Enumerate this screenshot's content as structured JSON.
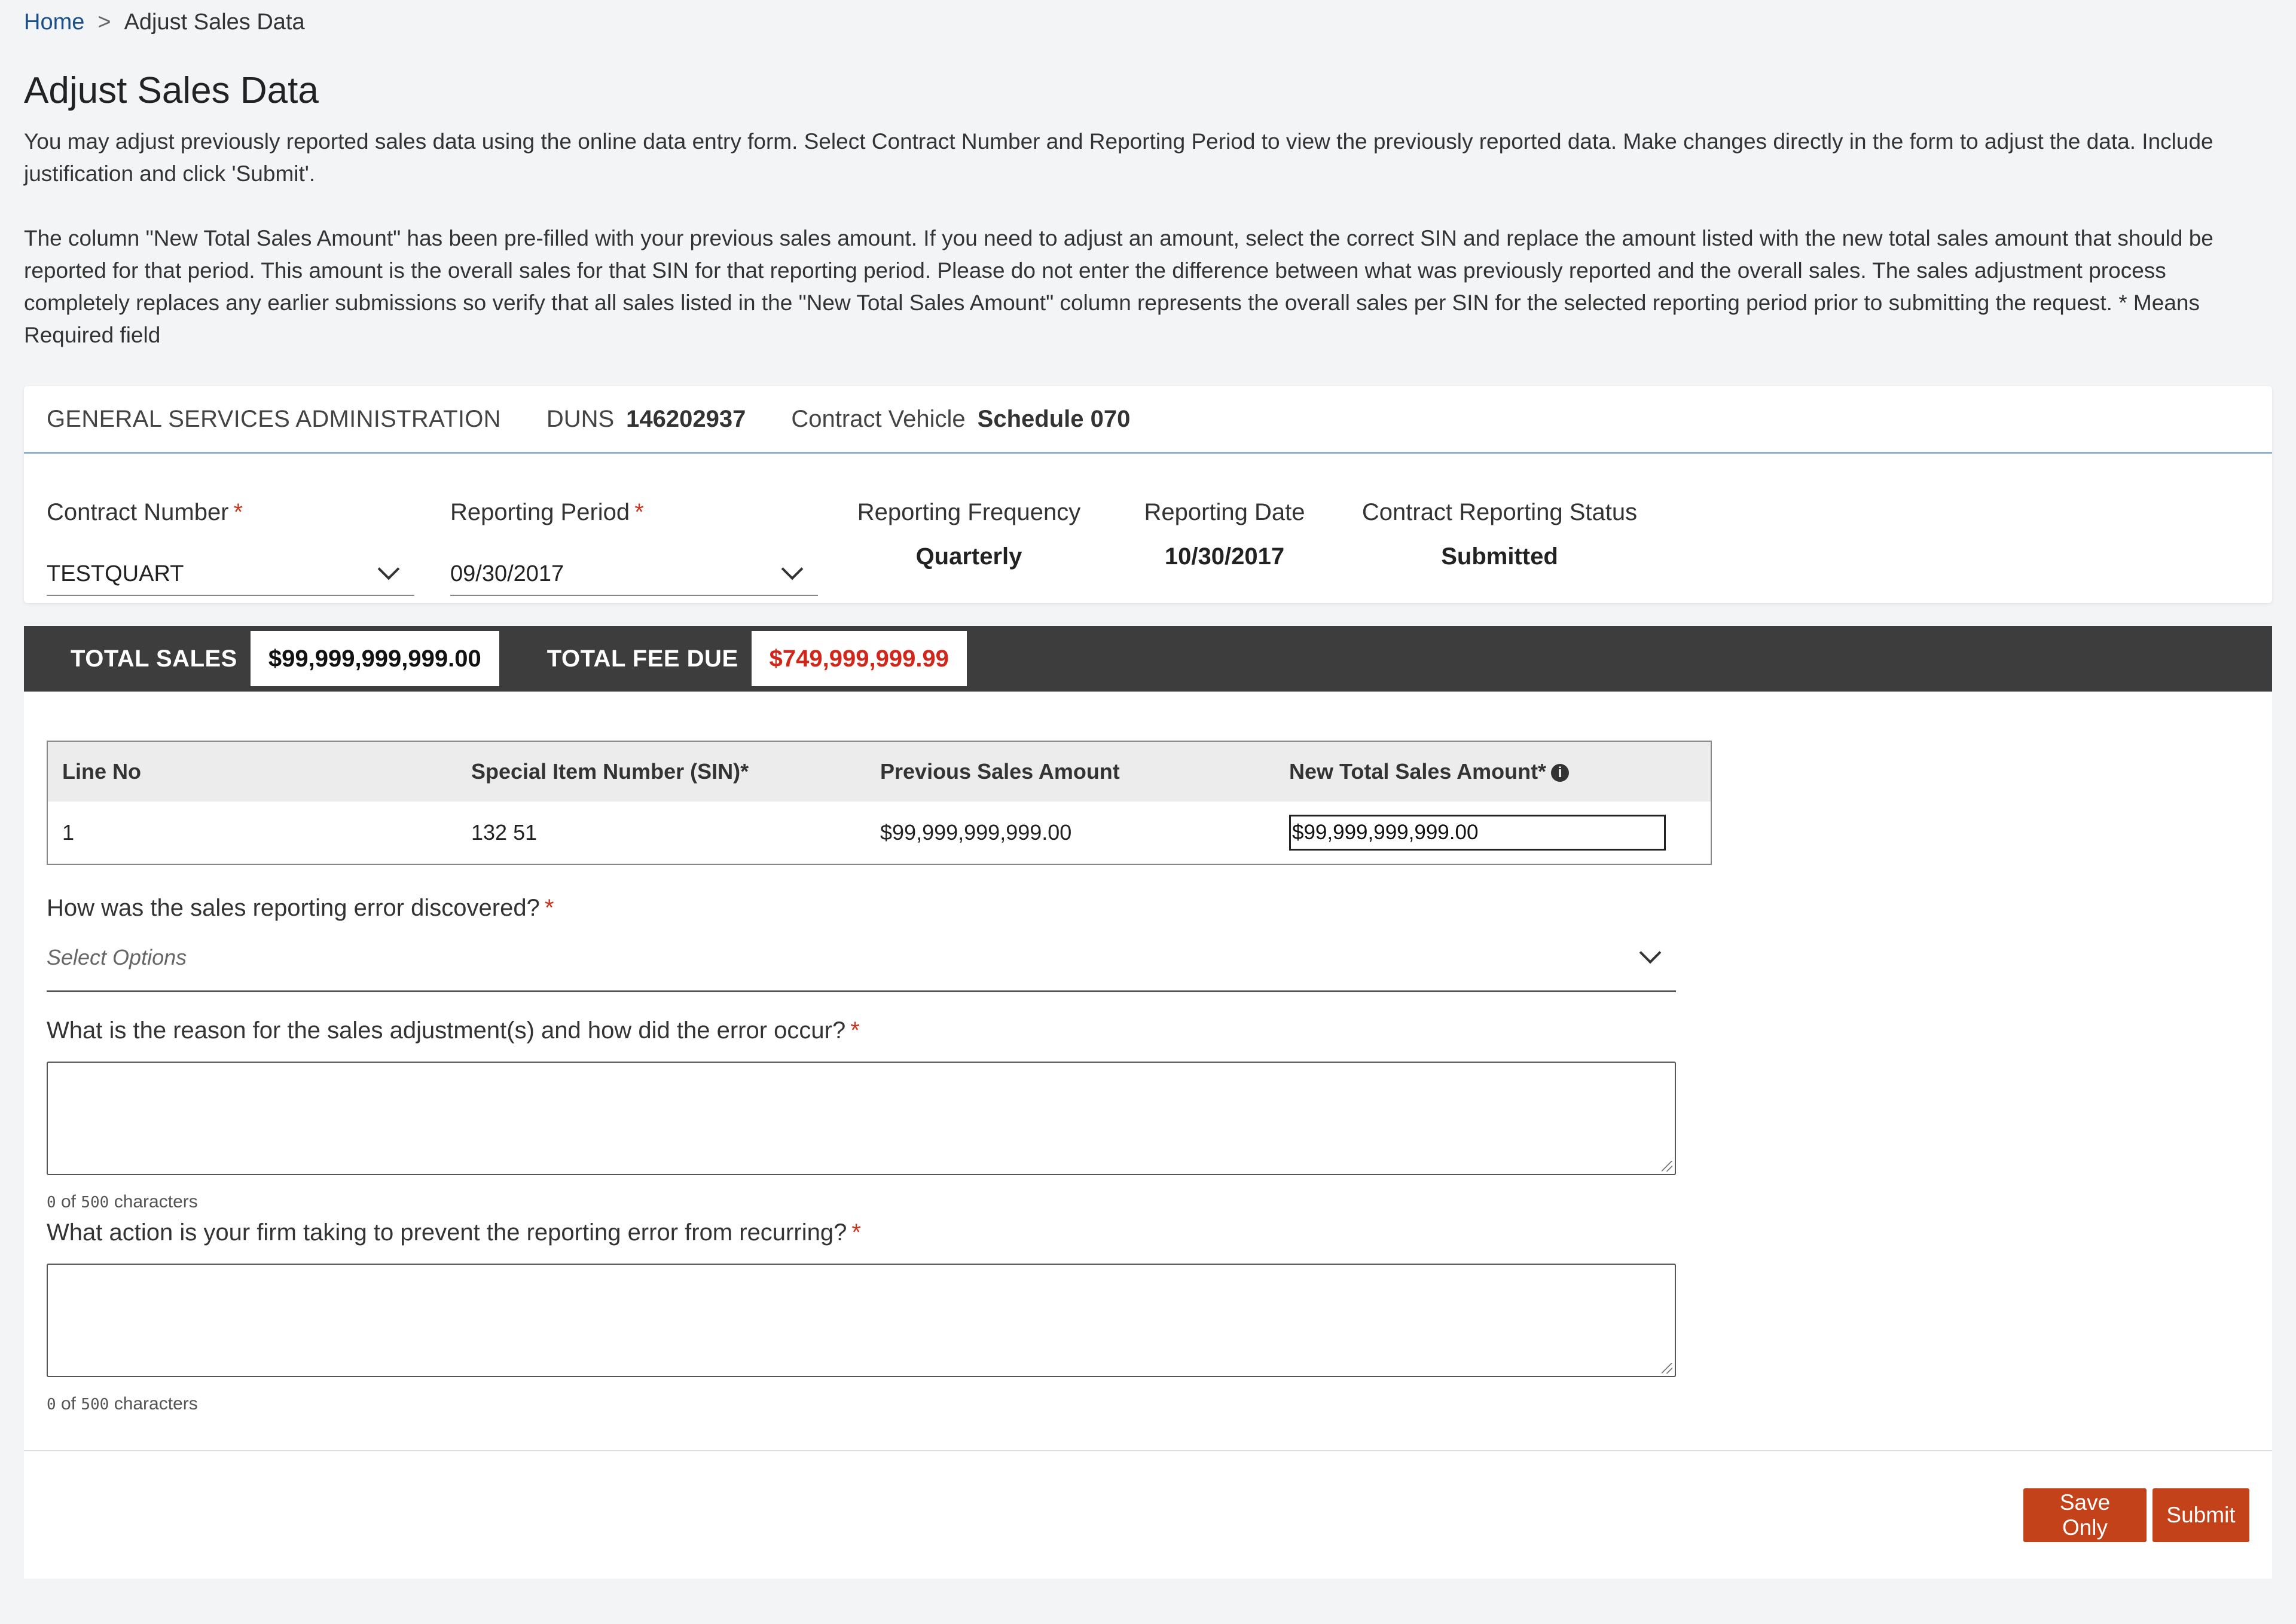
{
  "breadcrumb": {
    "home": "Home",
    "separator": ">",
    "current": "Adjust Sales Data"
  },
  "page": {
    "title": "Adjust Sales Data",
    "intro_1": "You may adjust previously reported sales data using the online data entry form. Select Contract Number and Reporting Period to view the previously reported data. Make changes directly in the form to adjust the data. Include justification and click 'Submit'.",
    "intro_2": "The column \"New Total Sales Amount\" has been pre-filled with your previous sales amount. If you need to adjust an amount, select the correct SIN and replace the amount listed with the new total sales amount that should be reported for that period. This amount is the overall sales for that SIN for that reporting period. Please do not enter the difference between what was previously reported and the overall sales. The sales adjustment process completely replaces any earlier submissions so verify that all sales listed in the \"New Total Sales Amount\" column represents the overall sales per SIN for the selected reporting period prior to submitting the request. * Means Required field"
  },
  "org": {
    "name": "GENERAL SERVICES ADMINISTRATION",
    "duns_label": "DUNS",
    "duns_value": "146202937",
    "vehicle_label": "Contract Vehicle",
    "vehicle_value": "Schedule 070"
  },
  "fields": {
    "contract_number": {
      "label": "Contract Number",
      "value": "TESTQUART"
    },
    "reporting_period": {
      "label": "Reporting Period",
      "value": "09/30/2017"
    },
    "reporting_frequency": {
      "label": "Reporting Frequency",
      "value": "Quarterly"
    },
    "reporting_date": {
      "label": "Reporting Date",
      "value": "10/30/2017"
    },
    "status": {
      "label": "Contract Reporting Status",
      "value": "Submitted"
    },
    "required_mark": "*"
  },
  "totals": {
    "sales_label": "TOTAL SALES",
    "sales_value": "$99,999,999,999.00",
    "fee_label": "TOTAL FEE DUE",
    "fee_value": "$749,999,999.99",
    "fee_color": "#d3261b"
  },
  "table": {
    "headers": [
      "Line No",
      "Special Item Number (SIN)*",
      "Previous Sales Amount",
      "New Total Sales Amount*"
    ],
    "rows": [
      {
        "line": "1",
        "sin": "132 51",
        "previous": "$99,999,999,999.00",
        "new_total": "$99,999,999,999.00"
      }
    ]
  },
  "questions": {
    "q1": {
      "label": "How was the sales reporting error discovered?",
      "placeholder": "Select Options"
    },
    "q2": {
      "label": "What is the reason for the sales adjustment(s) and how did the error occur?",
      "counter_num": "0",
      "counter_mid": "of",
      "counter_max": "500",
      "counter_suffix": "characters"
    },
    "q3": {
      "label": "What action is your firm taking to prevent the reporting error from recurring?",
      "counter_num": "0",
      "counter_mid": "of",
      "counter_max": "500",
      "counter_suffix": "characters"
    }
  },
  "buttons": {
    "save": "Save Only",
    "submit": "Submit",
    "accent": "#c4421a"
  },
  "icons": {
    "info": "info-icon",
    "chevron": "chevron-down-icon"
  }
}
